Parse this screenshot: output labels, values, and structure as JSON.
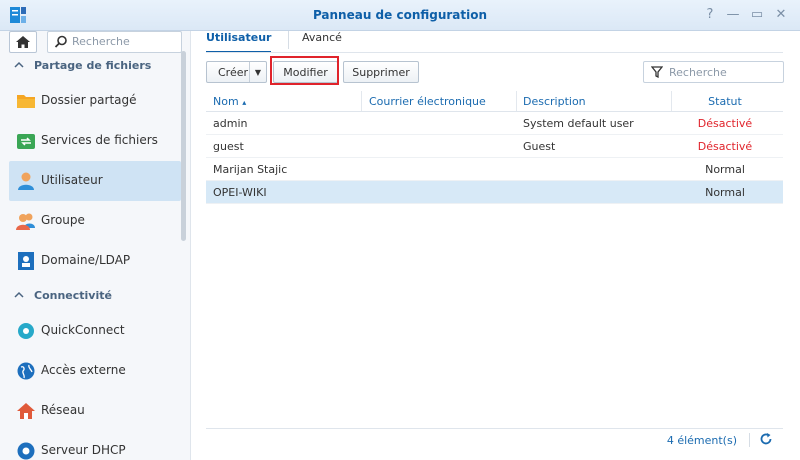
{
  "window": {
    "title": "Panneau de configuration",
    "help": "?",
    "minimize": "—",
    "maximize": "▭",
    "close": "✕"
  },
  "sidebar": {
    "search_placeholder": "Recherche",
    "sections": [
      {
        "label": "Partage de fichiers",
        "items": [
          {
            "label": "Dossier partagé",
            "icon": "folder-icon"
          },
          {
            "label": "Services de fichiers",
            "icon": "file-services-icon"
          },
          {
            "label": "Utilisateur",
            "icon": "user-icon",
            "active": true
          },
          {
            "label": "Groupe",
            "icon": "group-icon"
          },
          {
            "label": "Domaine/LDAP",
            "icon": "domain-icon"
          }
        ]
      },
      {
        "label": "Connectivité",
        "items": [
          {
            "label": "QuickConnect",
            "icon": "quickconnect-icon"
          },
          {
            "label": "Accès externe",
            "icon": "globe-icon"
          },
          {
            "label": "Réseau",
            "icon": "network-icon"
          },
          {
            "label": "Serveur DHCP",
            "icon": "dhcp-icon"
          }
        ]
      }
    ]
  },
  "tabs": [
    {
      "label": "Utilisateur",
      "active": true
    },
    {
      "label": "Avancé"
    }
  ],
  "toolbar": {
    "create": "Créer",
    "modify": "Modifier",
    "delete": "Supprimer",
    "search_placeholder": "Recherche"
  },
  "grid": {
    "columns": [
      "Nom",
      "Courrier électronique",
      "Description",
      "Statut"
    ],
    "sort_indicator": "▴",
    "rows": [
      {
        "name": "admin",
        "email": "",
        "description": "System default user",
        "status": "Désactivé"
      },
      {
        "name": "guest",
        "email": "",
        "description": "Guest",
        "status": "Désactivé"
      },
      {
        "name": "Marijan Stajic",
        "email": "",
        "description": "",
        "status": "Normal"
      },
      {
        "name": "OPEI-WIKI",
        "email": "",
        "description": "",
        "status": "Normal",
        "selected": true
      }
    ]
  },
  "footer": {
    "count": "4 élément(s)"
  },
  "colors": {
    "accent": "#0e5fa8",
    "disabled": "#e0232b",
    "selected_row": "#d7e9f7"
  }
}
